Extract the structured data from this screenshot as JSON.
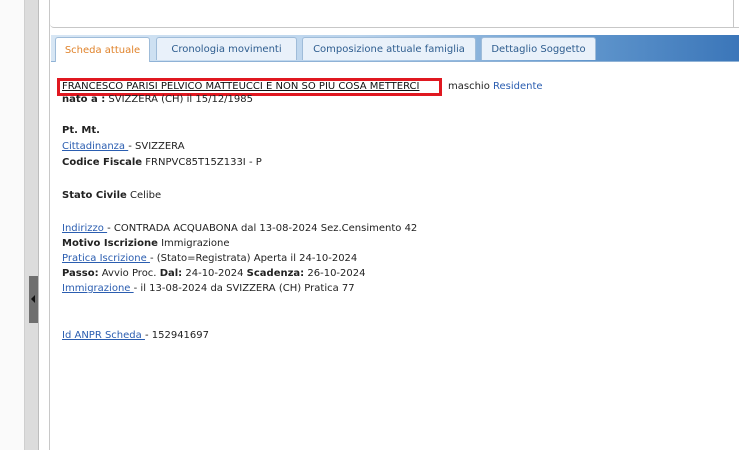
{
  "tabs": [
    {
      "label": "Scheda attuale"
    },
    {
      "label": "Cronologia movimenti"
    },
    {
      "label": "Composizione attuale famiglia"
    },
    {
      "label": "Dettaglio Soggetto"
    }
  ],
  "person": {
    "full_name": "FRANCESCO PARISI PELVICO MATTEUCCI E NON SO PIU COSA METTERCI",
    "sex": "maschio",
    "status_link": "Residente",
    "birth_label": "nato a :",
    "birth_value": "SVIZZERA (CH) il 15/12/1985"
  },
  "details": {
    "pt_mt_label": "Pt. Mt.",
    "cittadinanza_label": "Cittadinanza ",
    "cittadinanza_value": "- SVIZZERA",
    "codice_fiscale_label": "Codice Fiscale",
    "codice_fiscale_value": "FRNPVC85T15Z133I - P",
    "stato_civile_label": "Stato Civile",
    "stato_civile_value": "Celibe",
    "indirizzo_label": "Indirizzo ",
    "indirizzo_value": "- CONTRADA ACQUABONA dal 13-08-2024 Sez.Censimento 42",
    "motivo_label": "Motivo Iscrizione",
    "motivo_value": "Immigrazione",
    "pratica_label": "Pratica Iscrizione ",
    "pratica_value": "- (Stato=Registrata) Aperta il 24-10-2024",
    "passo_label": "Passo:",
    "passo_value": "Avvio Proc.",
    "dal_label": "Dal:",
    "dal_value": "24-10-2024",
    "scadenza_label": "Scadenza:",
    "scadenza_value": "26-10-2024",
    "immigrazione_label": "Immigrazione ",
    "immigrazione_value": "- il 13-08-2024 da SVIZZERA (CH) Pratica 77",
    "anpr_label": "Id ANPR Scheda ",
    "anpr_value": "- 152941697"
  }
}
